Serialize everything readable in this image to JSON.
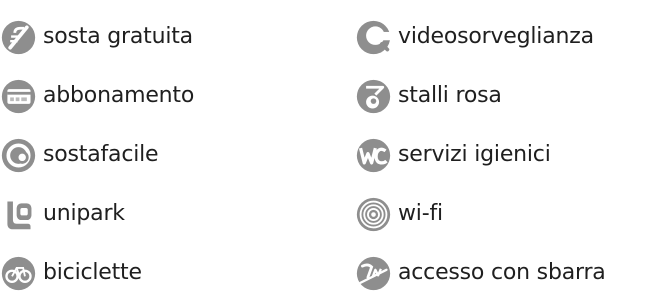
{
  "amenities": {
    "left": [
      {
        "label": "sosta gratuita",
        "icon": "free-parking-icon"
      },
      {
        "label": "abbonamento",
        "icon": "subscription-card-icon"
      },
      {
        "label": "sostafacile",
        "icon": "sostafacile-icon"
      },
      {
        "label": "unipark",
        "icon": "unipark-icon"
      },
      {
        "label": "biciclette",
        "icon": "bicycle-icon"
      }
    ],
    "right": [
      {
        "label": "videosorveglianza",
        "icon": "security-camera-icon"
      },
      {
        "label": "stalli rosa",
        "icon": "pink-stall-icon"
      },
      {
        "label": "servizi igienici",
        "icon": "wc-icon"
      },
      {
        "label": "wi-fi",
        "icon": "wifi-icon"
      },
      {
        "label": "accesso con sbarra",
        "icon": "barrier-access-icon"
      }
    ]
  },
  "colors": {
    "icon": "#8e8e8e",
    "icon_dark": "#6f6f6f",
    "text": "#1f1f1f"
  }
}
